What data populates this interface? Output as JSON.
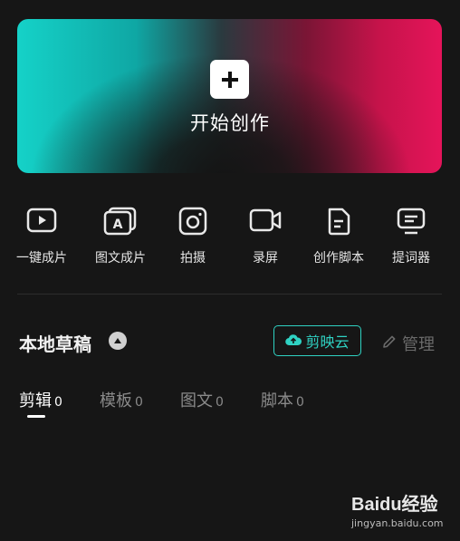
{
  "hero": {
    "title": "开始创作",
    "icon": "plus-icon"
  },
  "tools": [
    {
      "label": "一键成片",
      "icon": "play-icon"
    },
    {
      "label": "图文成片",
      "icon": "text-image-icon"
    },
    {
      "label": "拍摄",
      "icon": "camera-icon"
    },
    {
      "label": "录屏",
      "icon": "screen-record-icon"
    },
    {
      "label": "创作脚本",
      "icon": "script-icon"
    },
    {
      "label": "提词器",
      "icon": "teleprompter-icon"
    }
  ],
  "drafts": {
    "title": "本地草稿",
    "cloud_button": "剪映云",
    "manage_label": "管理",
    "tabs": [
      {
        "label": "剪辑",
        "count": "0",
        "active": true
      },
      {
        "label": "模板",
        "count": "0",
        "active": false
      },
      {
        "label": "图文",
        "count": "0",
        "active": false
      },
      {
        "label": "脚本",
        "count": "0",
        "active": false
      }
    ]
  },
  "watermark": {
    "brand": "Baidu经验",
    "url": "jingyan.baidu.com"
  },
  "colors": {
    "accent": "#2fd2c3",
    "background": "#161616"
  }
}
